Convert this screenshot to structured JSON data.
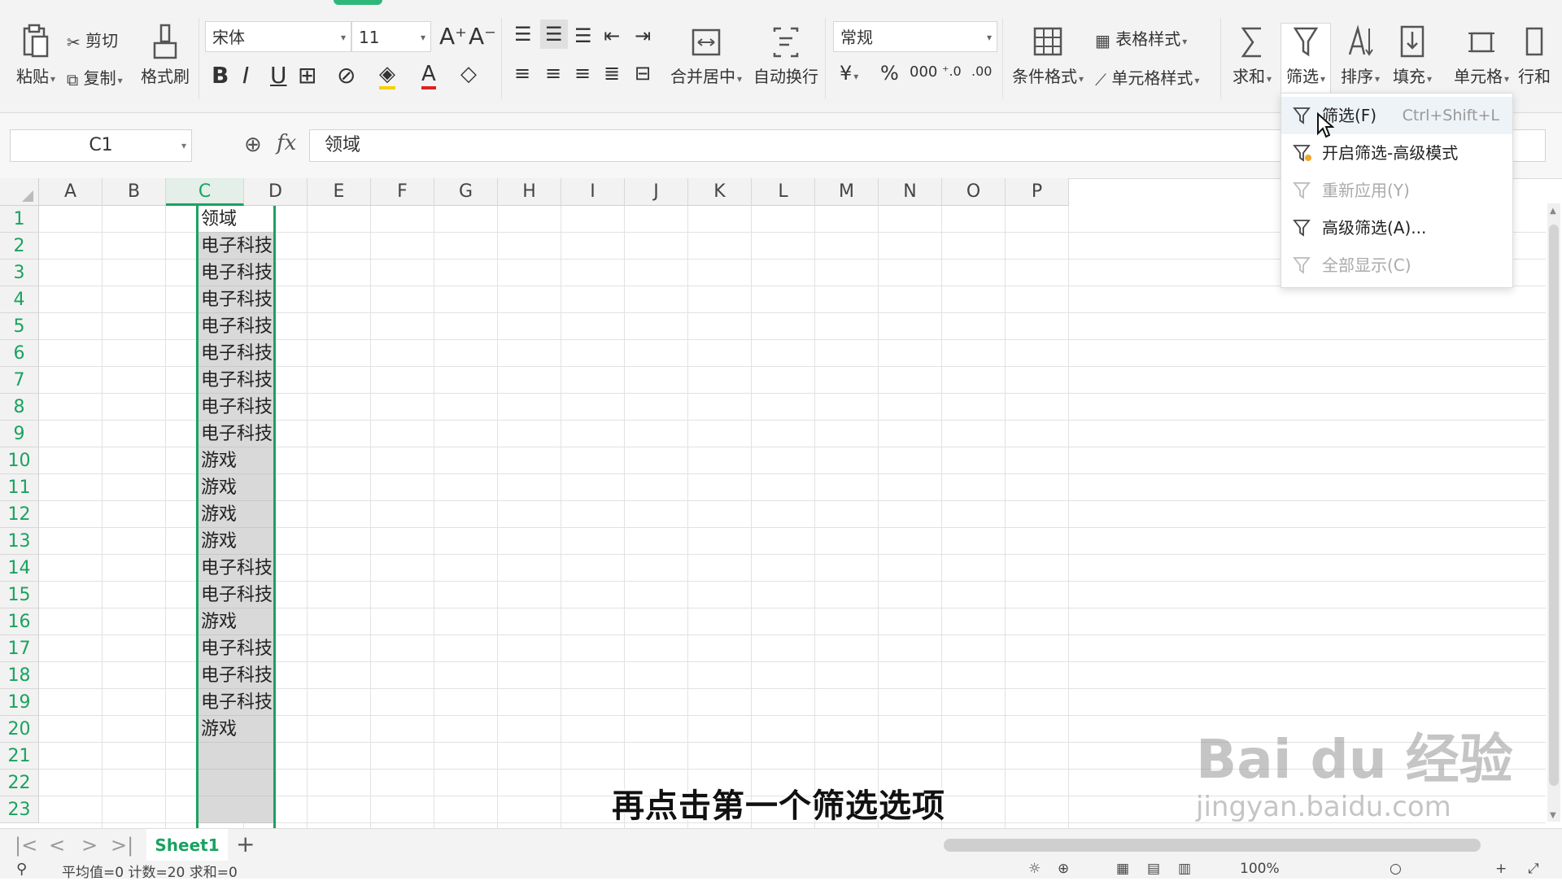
{
  "ribbon": {
    "paste": "粘贴",
    "cut": "剪切",
    "copy": "复制",
    "format_painter": "格式刷",
    "font_name": "宋体",
    "font_size": "11",
    "merge_center": "合并居中",
    "wrap_text": "自动换行",
    "number_format": "常规",
    "conditional_format": "条件格式",
    "table_style": "表格样式",
    "cell_style": "单元格样式",
    "sum": "求和",
    "filter": "筛选",
    "sort": "排序",
    "fill": "填充",
    "cell": "单元格",
    "row_col": "行和"
  },
  "formula_bar": {
    "name_box": "C1",
    "fx": "fx",
    "content": "领域"
  },
  "columns": [
    "A",
    "B",
    "C",
    "D",
    "E",
    "F",
    "G",
    "H",
    "I",
    "J",
    "K",
    "L",
    "M",
    "N",
    "O",
    "P"
  ],
  "rows": [
    "1",
    "2",
    "3",
    "4",
    "5",
    "6",
    "7",
    "8",
    "9",
    "10",
    "11",
    "12",
    "13",
    "14",
    "15",
    "16",
    "17",
    "18",
    "19",
    "20",
    "21",
    "22",
    "23"
  ],
  "column_c": [
    "领域",
    "电子科技",
    "电子科技",
    "电子科技",
    "电子科技",
    "电子科技",
    "电子科技",
    "电子科技",
    "电子科技",
    "游戏",
    "游戏",
    "游戏",
    "游戏",
    "电子科技",
    "电子科技",
    "游戏",
    "电子科技",
    "电子科技",
    "电子科技",
    "游戏",
    "",
    "",
    ""
  ],
  "filter_menu": {
    "items": [
      {
        "label": "筛选(F)",
        "shortcut": "Ctrl+Shift+L",
        "disabled": false
      },
      {
        "label": "开启筛选-高级模式",
        "shortcut": "",
        "disabled": false
      },
      {
        "label": "重新应用(Y)",
        "shortcut": "",
        "disabled": true
      },
      {
        "label": "高级筛选(A)...",
        "shortcut": "",
        "disabled": false
      },
      {
        "label": "全部显示(C)",
        "shortcut": "",
        "disabled": true
      }
    ]
  },
  "sheet_tabs": {
    "active": "Sheet1",
    "add": "+"
  },
  "status_bar": {
    "summary": "平均值=0 计数=20 求和=0",
    "zoom": "100%"
  },
  "subtitle": "再点击第一个筛选选项",
  "watermark": {
    "title": "Bai du 经验",
    "url": "jingyan.baidu.com"
  },
  "colors": {
    "accent": "#1aa260",
    "selected_fill": "#d9d9d9",
    "menu_hover": "#eef3f8"
  }
}
